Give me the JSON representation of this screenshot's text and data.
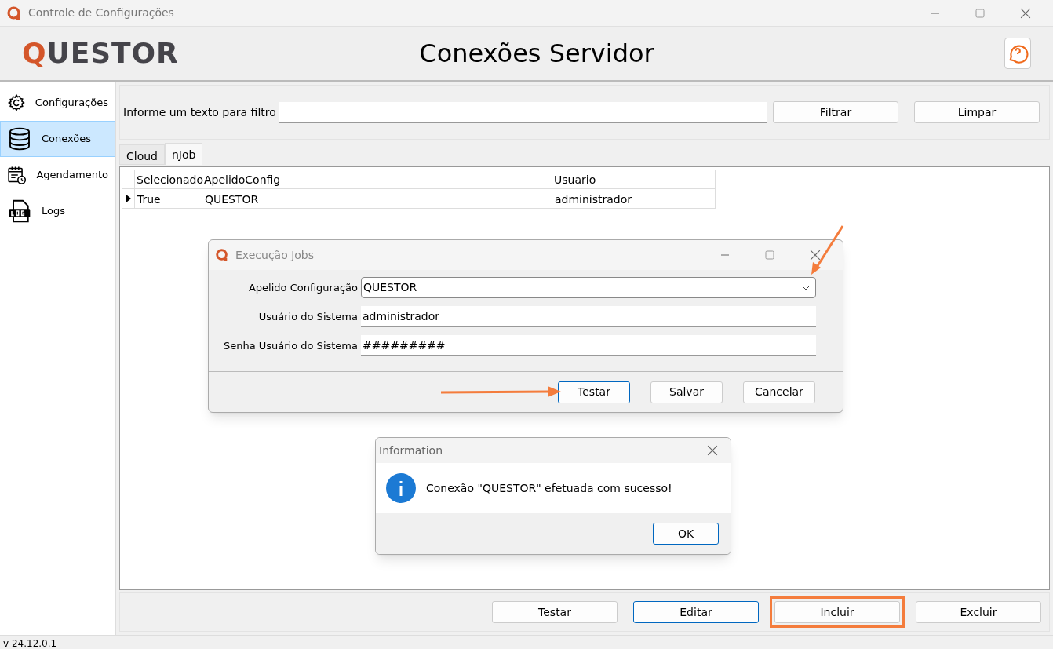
{
  "window": {
    "title": "Controle de Configurações"
  },
  "header": {
    "logo": "QUESTOR",
    "title": "Conexões Servidor"
  },
  "sidebar": {
    "items": [
      {
        "label": "Configurações",
        "kind": "gear",
        "selected": false
      },
      {
        "label": "Conexões",
        "kind": "database",
        "selected": true
      },
      {
        "label": "Agendamento",
        "kind": "calendar",
        "selected": false
      },
      {
        "label": "Logs",
        "kind": "log",
        "selected": false
      }
    ]
  },
  "filter": {
    "label": "Informe um texto para filtro",
    "buttons": [
      "Filtrar",
      "Limpar"
    ]
  },
  "tabs": [
    {
      "label": "Cloud",
      "selected": false
    },
    {
      "label": "nJob",
      "selected": true
    }
  ],
  "table": {
    "columns": [
      "Selecionado",
      "ApelidoConfig",
      "Usuario"
    ],
    "rows": [
      {
        "current": true,
        "cells": [
          "True",
          "QUESTOR",
          "administrador"
        ]
      }
    ]
  },
  "bottom_buttons": [
    {
      "label": "Testar",
      "focused": false,
      "highlighted": false
    },
    {
      "label": "Editar",
      "focused": true,
      "highlighted": false
    },
    {
      "label": "Incluir",
      "focused": false,
      "highlighted": true
    },
    {
      "label": "Excluir",
      "focused": false,
      "highlighted": false
    }
  ],
  "status_bar": "v 24.12.0.1",
  "jobs_dialog": {
    "title": "Execução Jobs",
    "fields": [
      {
        "label": "Apelido Configuração",
        "value": "QUESTOR",
        "kind": "dropdown"
      },
      {
        "label": "Usuário do Sistema",
        "value": "administrador",
        "kind": "text"
      },
      {
        "label": "Senha Usuário do Sistema",
        "value": "#########",
        "kind": "text"
      }
    ],
    "buttons": [
      {
        "label": "Testar",
        "focused": true
      },
      {
        "label": "Salvar",
        "focused": false
      },
      {
        "label": "Cancelar",
        "focused": false
      }
    ]
  },
  "info_dialog": {
    "title": "Information",
    "message": "Conexão \"QUESTOR\" efetuada com sucesso!",
    "button": "OK"
  }
}
